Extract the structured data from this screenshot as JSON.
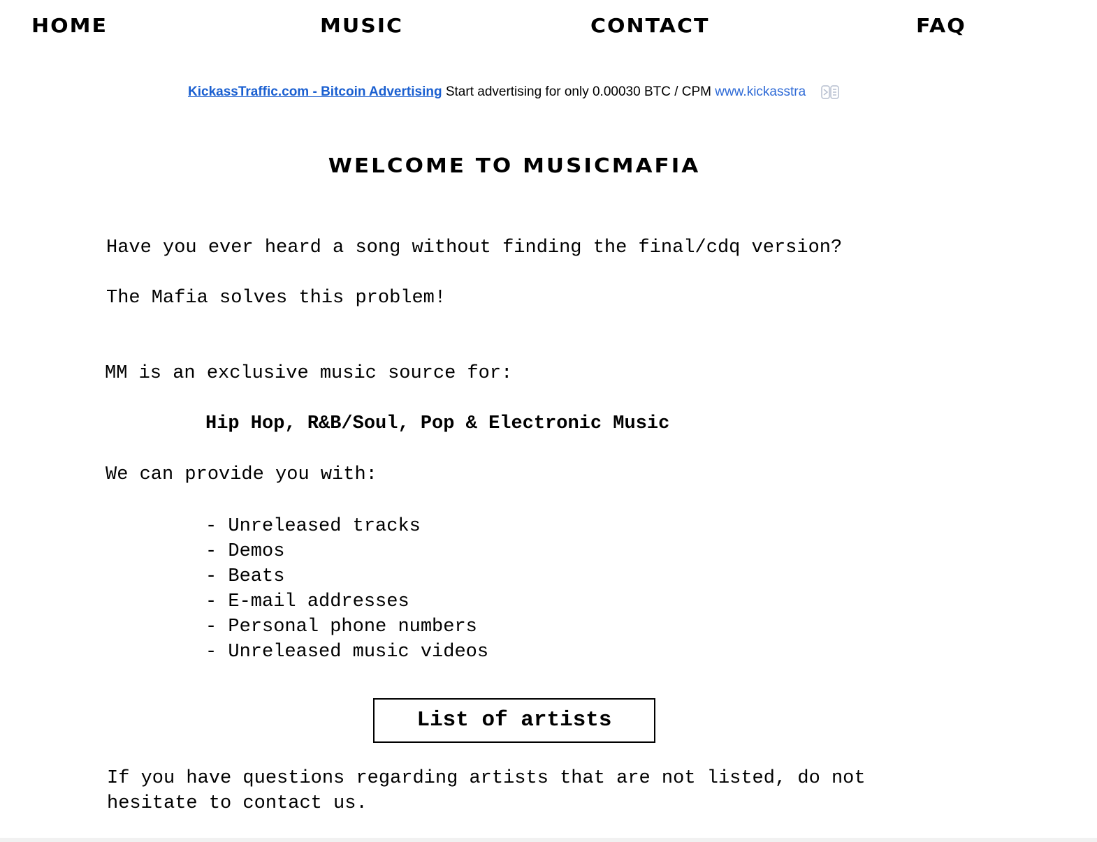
{
  "nav": {
    "home": "HOME",
    "music": "MUSIC",
    "contact": "CONTACT",
    "faq": "FAQ"
  },
  "ad": {
    "title": "KickassTraffic.com - Bitcoin Advertising",
    "text": "Start advertising for only 0.00030 BTC / CPM",
    "url": "www.kickasstra",
    "badge_icon": "ad-choices-icon",
    "link_color": "#1a5fd0"
  },
  "page": {
    "heading": "WELCOME TO MUSICMAFIA",
    "question": "Have you ever heard a song without finding the final/cdq version?",
    "answer": "The Mafia solves this problem!",
    "intro": "MM is an exclusive music source for:",
    "genres": "Hip Hop, R&B/Soul, Pop & Electronic Music",
    "provide": "We can provide you with:",
    "features": [
      "- Unreleased tracks",
      "- Demos",
      "- Beats",
      "- E-mail addresses",
      "- Personal phone numbers",
      "- Unreleased music videos"
    ],
    "artists_button": "List of artists",
    "questions_note": "If you have questions regarding artists that are not listed, do not hesitate to contact us."
  }
}
